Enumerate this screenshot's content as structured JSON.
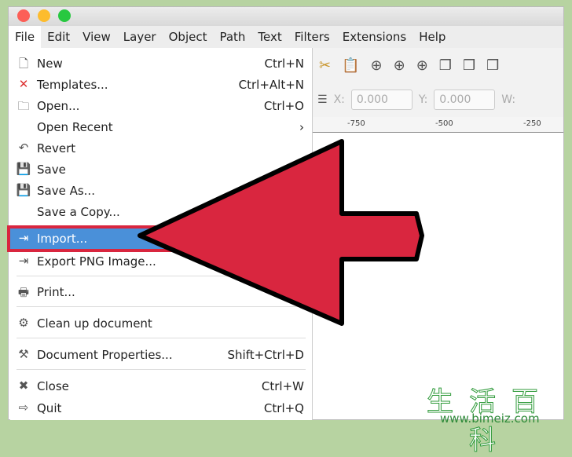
{
  "menubar": [
    "File",
    "Edit",
    "View",
    "Layer",
    "Object",
    "Path",
    "Text",
    "Filters",
    "Extensions",
    "Help"
  ],
  "file_menu": [
    {
      "label": "New",
      "shortcut": "Ctrl+N",
      "icon": "new-document-icon"
    },
    {
      "label": "Templates...",
      "shortcut": "Ctrl+Alt+N",
      "icon": "templates-icon"
    },
    {
      "label": "Open...",
      "shortcut": "Ctrl+O",
      "icon": "folder-icon"
    },
    {
      "label": "Open Recent",
      "shortcut": "›",
      "icon": ""
    },
    {
      "label": "Revert",
      "shortcut": "",
      "icon": "revert-icon"
    },
    {
      "label": "Save",
      "shortcut": "Ctrl",
      "icon": "save-icon"
    },
    {
      "label": "Save As...",
      "shortcut": "Shi",
      "icon": "save-as-icon"
    },
    {
      "label": "Save a Copy...",
      "shortcut": "",
      "icon": ""
    },
    {
      "label": "Import...",
      "shortcut": "",
      "icon": "import-icon"
    },
    {
      "label": "Export PNG Image...",
      "shortcut": "",
      "icon": "export-icon"
    },
    {
      "label": "Print...",
      "shortcut": "",
      "icon": "print-icon"
    },
    {
      "label": "Clean up document",
      "shortcut": "",
      "icon": "vacuum-icon"
    },
    {
      "label": "Document Properties...",
      "shortcut": "Shift+Ctrl+D",
      "icon": "document-properties-icon"
    },
    {
      "label": "Close",
      "shortcut": "Ctrl+W",
      "icon": "close-icon"
    },
    {
      "label": "Quit",
      "shortcut": "Ctrl+Q",
      "icon": "quit-icon"
    }
  ],
  "toolbar": {
    "x_label": "X:",
    "x_value": "0.000",
    "y_label": "Y:",
    "y_value": "0.000",
    "w_label": "W:"
  },
  "ruler": [
    "-750",
    "-500",
    "-250"
  ],
  "watermark": {
    "text": "生活百科",
    "url": "www.bimeiz.com"
  },
  "colors": {
    "highlight": "#4a90d9",
    "arrow": "#d9263f",
    "background": "#b7d3a1"
  }
}
